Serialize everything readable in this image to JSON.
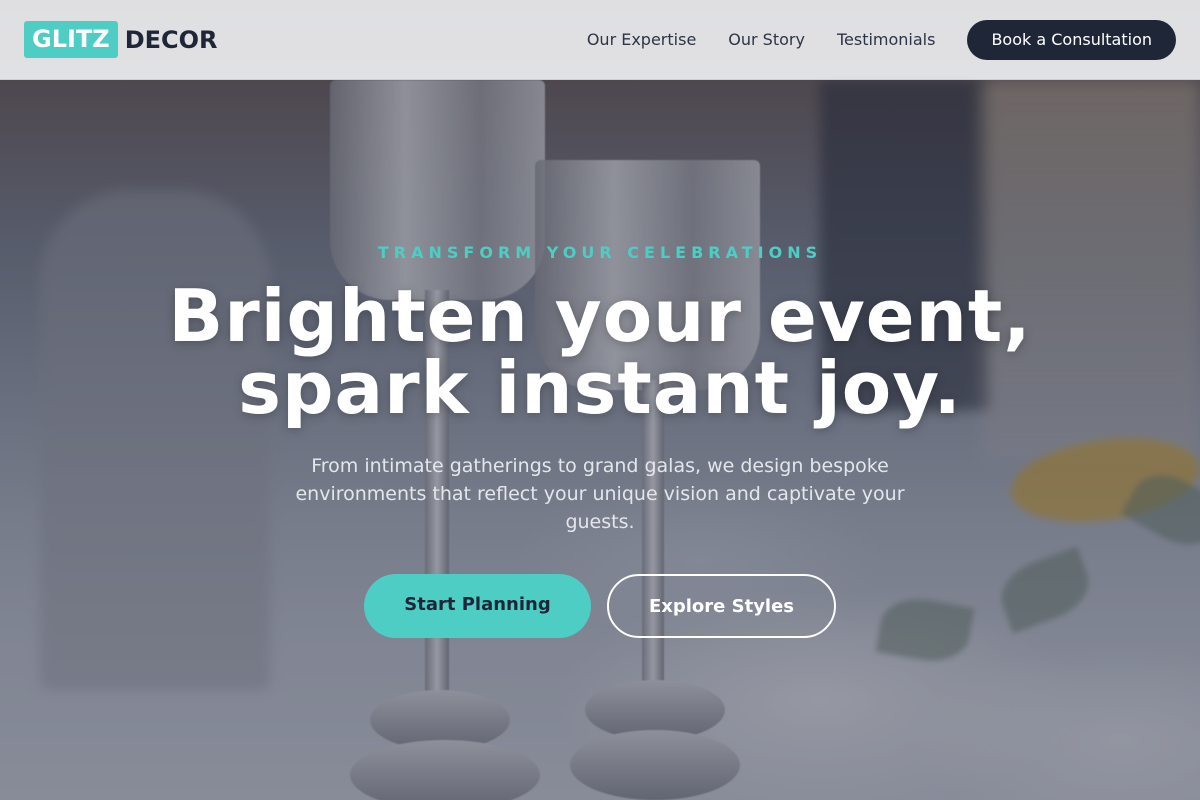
{
  "brand": {
    "logo_highlight": "GLITZ",
    "logo_text": "DECOR",
    "accent_color": "#4ecdc4",
    "dark_color": "#1e2638"
  },
  "nav": {
    "links": [
      {
        "label": "Our Expertise"
      },
      {
        "label": "Our Story"
      },
      {
        "label": "Testimonials"
      }
    ],
    "cta_label": "Book a Consultation"
  },
  "hero": {
    "eyebrow": "TRANSFORM YOUR CELEBRATIONS",
    "headline_line1": "Brighten your event,",
    "headline_line2": "spark instant joy.",
    "subtitle": "From intimate gatherings to grand galas, we design bespoke environments that reflect your unique vision and captivate your guests.",
    "primary_button": "Start Planning",
    "secondary_button": "Explore Styles"
  }
}
